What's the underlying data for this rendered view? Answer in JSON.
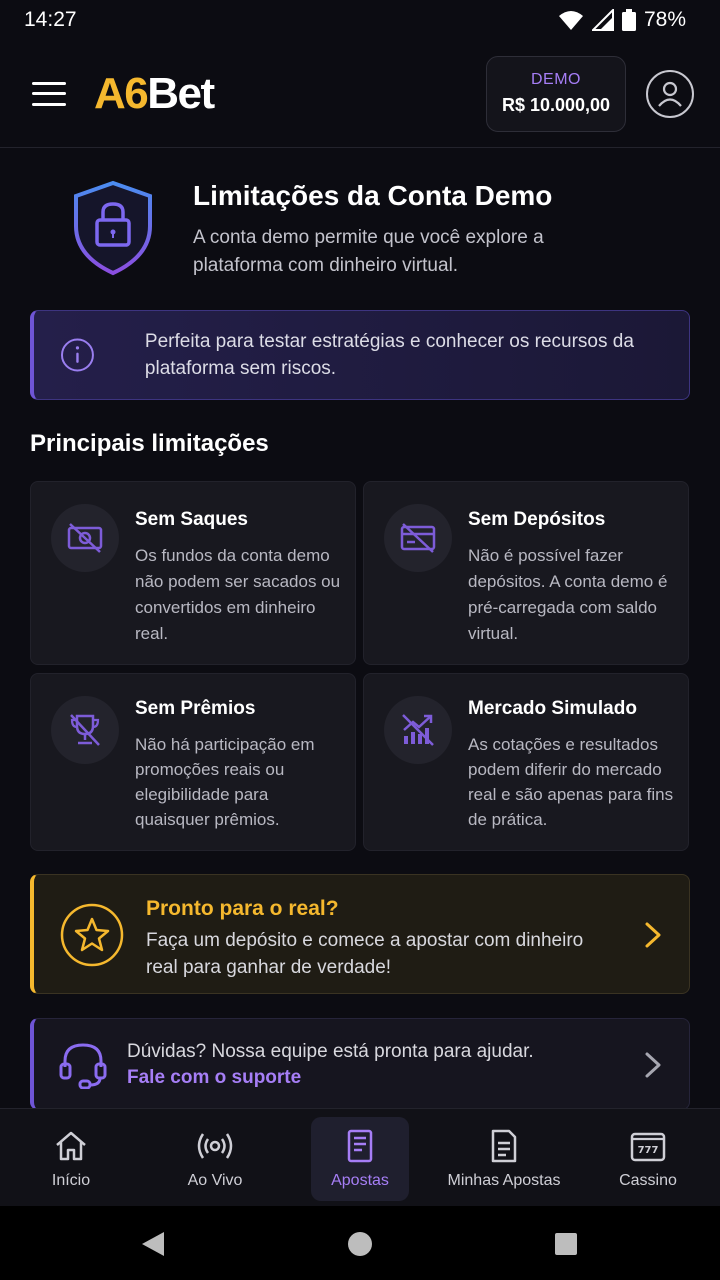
{
  "status": {
    "time": "14:27",
    "battery": "78%"
  },
  "header": {
    "logo_a6": "A6",
    "logo_bet": "Bet",
    "demo_label": "DEMO",
    "demo_balance": "R$ 10.000,00"
  },
  "hero": {
    "title": "Limitações da Conta Demo",
    "subtitle": "A conta demo permite que você explore a plataforma com dinheiro virtual."
  },
  "info": {
    "text": "Perfeita para testar estratégias e conhecer os recursos da plataforma sem riscos."
  },
  "section_title": "Principais limitações",
  "limitations": [
    {
      "title": "Sem Saques",
      "desc": "Os fundos da conta demo não podem ser sacados ou convertidos em dinheiro real.",
      "icon": "no-cash-icon"
    },
    {
      "title": "Sem Depósitos",
      "desc": "Não é possível fazer depósitos. A conta demo é pré-carregada com saldo virtual.",
      "icon": "no-card-icon"
    },
    {
      "title": "Sem Prêmios",
      "desc": "Não há participação em promoções reais ou elegibilidade para quaisquer prêmios.",
      "icon": "no-trophy-icon"
    },
    {
      "title": "Mercado Simulado",
      "desc": "As cotações e resultados podem diferir do mercado real e são apenas para fins de prática.",
      "icon": "simulated-chart-icon"
    }
  ],
  "cta": {
    "title": "Pronto para o real?",
    "desc": "Faça um depósito e comece a apostar com dinheiro real para ganhar de verdade!"
  },
  "support": {
    "question": "Dúvidas? Nossa equipe está pronta para ajudar.",
    "link": "Fale com o suporte"
  },
  "nav": {
    "items": [
      {
        "label": "Início",
        "icon": "home-icon"
      },
      {
        "label": "Ao Vivo",
        "icon": "live-icon"
      },
      {
        "label": "Apostas",
        "icon": "bets-icon",
        "active": true
      },
      {
        "label": "Minhas Apostas",
        "icon": "my-bets-icon"
      },
      {
        "label": "Cassino",
        "icon": "casino-icon"
      }
    ]
  },
  "colors": {
    "accent_purple": "#a67ef6",
    "accent_gold": "#f5b82e",
    "background": "#0c0c12"
  }
}
